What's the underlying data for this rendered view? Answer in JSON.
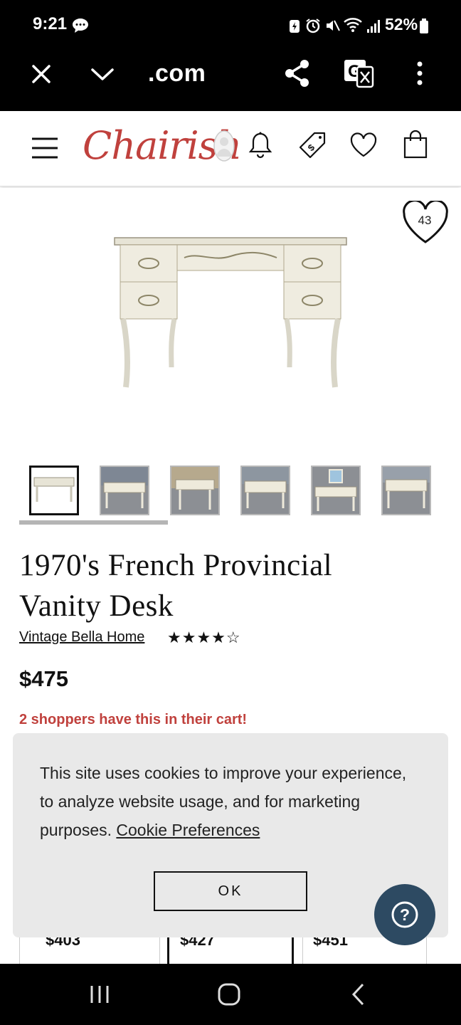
{
  "status_bar": {
    "time": "9:21",
    "battery": "52%"
  },
  "browser": {
    "url": ".com"
  },
  "site": {
    "logo": "Chairish"
  },
  "product": {
    "favorites_count": "43",
    "title_line1": "1970's French Provincial",
    "title_line2": "Vanity Desk",
    "seller": "Vintage Bella Home",
    "rating_stars": "★★★★☆",
    "price": "$475",
    "cart_alert": "2 shoppers have this in their cart!"
  },
  "similar_prices": [
    "$403",
    "$427",
    "$451"
  ],
  "cookie_banner": {
    "text": "This site uses cookies to improve your experience, to analyze website usage, and for marketing purposes. ",
    "link": "Cookie Preferences",
    "ok": "OK"
  },
  "help": {
    "label": "?"
  },
  "colors": {
    "brand": "#c0413d",
    "help_button": "#2d4a62",
    "banner_bg": "#e9e9e9"
  },
  "icons": [
    "message-icon",
    "battery-icon",
    "alarm-icon",
    "mute-icon",
    "wifi-icon",
    "signal-icon",
    "close-icon",
    "chevron-down-icon",
    "share-icon",
    "translate-icon",
    "more-icon",
    "menu-icon",
    "user-icon",
    "bell-icon",
    "tag-icon",
    "heart-icon",
    "bag-icon"
  ]
}
